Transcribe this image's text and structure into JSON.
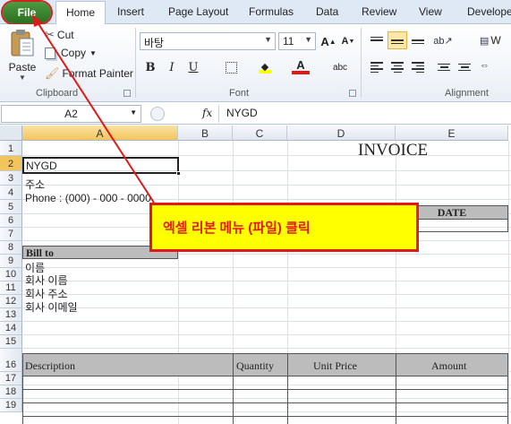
{
  "tabs": {
    "file": "File",
    "home": "Home",
    "insert": "Insert",
    "page_layout": "Page Layout",
    "formulas": "Formulas",
    "data": "Data",
    "review": "Review",
    "view": "View",
    "developer": "Develope"
  },
  "clipboard": {
    "paste": "Paste",
    "cut": "Cut",
    "copy": "Copy",
    "format_painter": "Format Painter",
    "label": "Clipboard"
  },
  "font": {
    "name": "바탕",
    "size": "11",
    "bold": "B",
    "italic": "I",
    "underline": "U",
    "grow": "A",
    "shrink": "A",
    "label": "Font",
    "font_color": "#e01818"
  },
  "alignment": {
    "label": "Alignment",
    "wrap": "W"
  },
  "formula_bar": {
    "name_box": "A2",
    "fx": "fx",
    "value": "NYGD"
  },
  "columns": [
    "A",
    "B",
    "C",
    "D",
    "E"
  ],
  "rows": [
    "1",
    "2",
    "3",
    "4",
    "5",
    "6",
    "7",
    "8",
    "9",
    "10",
    "11",
    "12",
    "13",
    "14",
    "15",
    "16",
    "17",
    "18",
    "19"
  ],
  "cells": {
    "invoice_title": "INVOICE",
    "a2": "NYGD",
    "a3": "주소",
    "a4": "Phone : (000) - 000 - 0000",
    "date_header": "DATE",
    "bill_to": "Bill to",
    "a9": "이름",
    "a10": "회사 이름",
    "a11": "회사 주소",
    "a12": "회사 이메일",
    "description": "Description",
    "quantity": "Quantity",
    "unit_price": "Unit Price",
    "amount": "Amount"
  },
  "annotation": {
    "text": "엑셀 리본 메뉴 (파일) 클릭",
    "color": "#e01818"
  }
}
